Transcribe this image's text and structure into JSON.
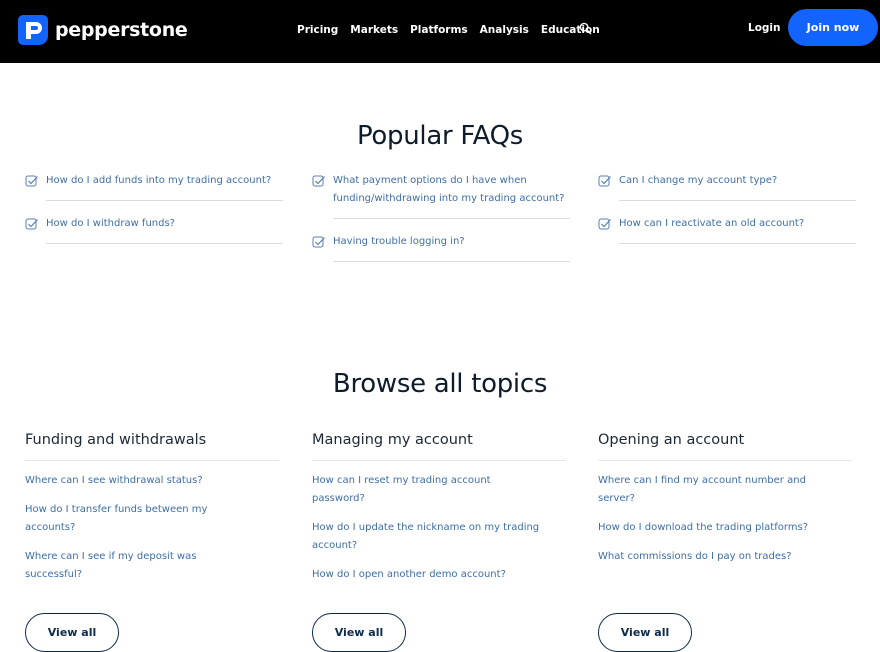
{
  "header": {
    "logo_text": "pepperstone",
    "nav": [
      "Pricing",
      "Markets",
      "Platforms",
      "Analysis",
      "Education"
    ],
    "login_label": "Login",
    "join_label": "Join now",
    "search_icon": "search-icon",
    "brand_color": "#1363ff"
  },
  "faq": {
    "title": "Popular FAQs",
    "columns": [
      [
        "How do I add funds into my trading account?",
        "How do I withdraw funds?"
      ],
      [
        "What payment options do I have when funding/withdrawing into my trading account?",
        "Having trouble logging in?"
      ],
      [
        "Can I change my account type?",
        "How can I reactivate an old account?"
      ]
    ]
  },
  "topics": {
    "title": "Browse all topics",
    "columns": [
      {
        "heading": "Funding and withdrawals",
        "links": [
          "Where can I see withdrawal status?",
          "How do I transfer funds between my accounts?",
          "Where can I see if my deposit was successful?"
        ],
        "button": "View all"
      },
      {
        "heading": "Managing my account",
        "links": [
          "How can I reset my trading account password?",
          "How do I update the nickname on my trading account?",
          "How do I open another demo account?"
        ],
        "button": "View all"
      },
      {
        "heading": "Opening an account",
        "links": [
          "Where can I find my account number and server?",
          "How do I download the trading platforms?",
          "What commissions do I pay on trades?"
        ],
        "button": "View all"
      }
    ]
  }
}
